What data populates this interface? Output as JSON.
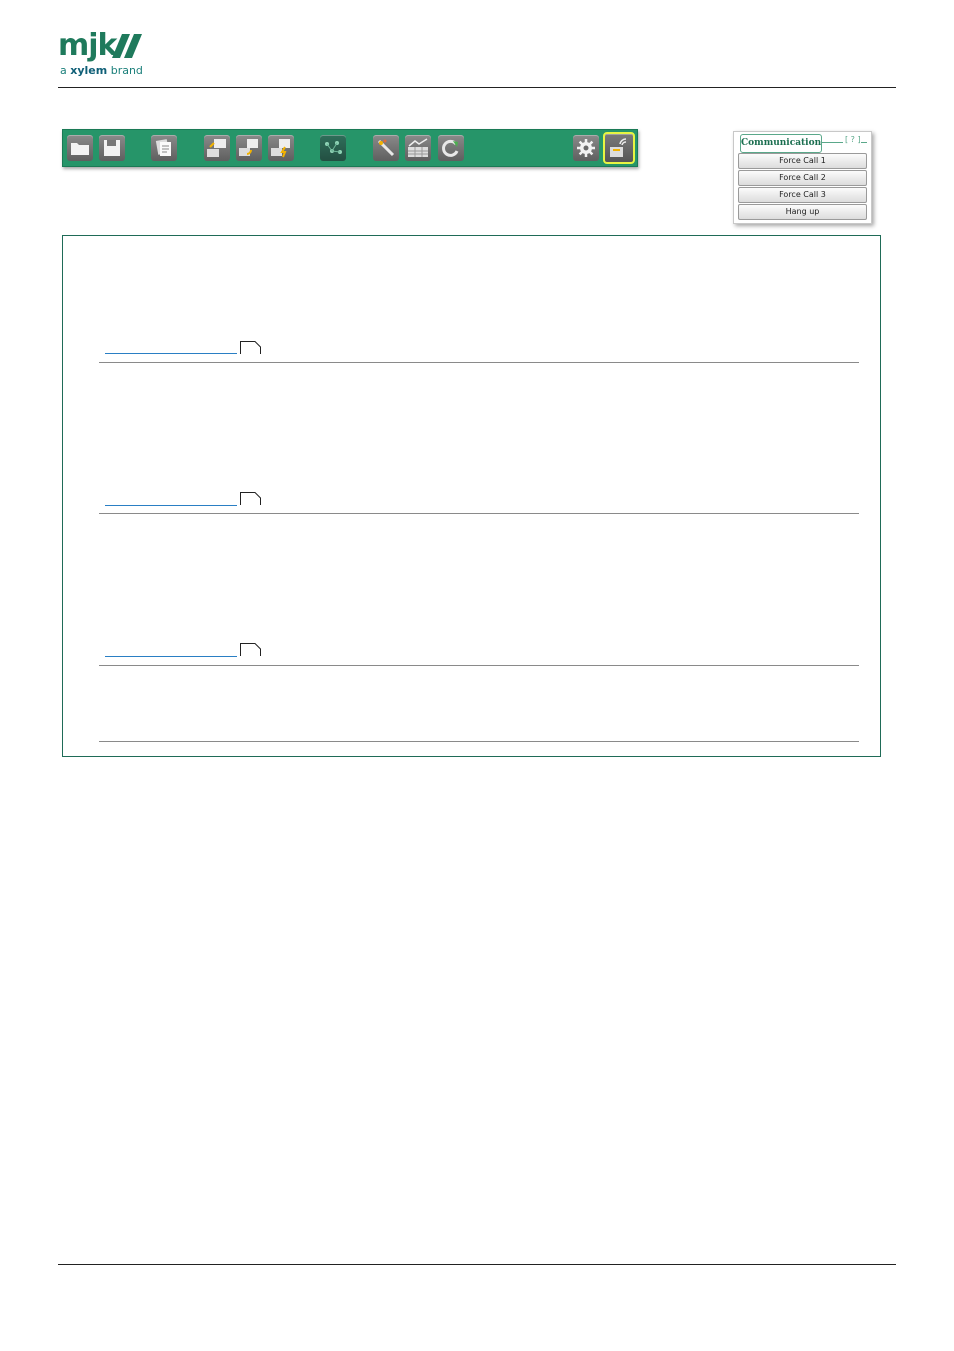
{
  "header": {
    "logo_text": "mjk//",
    "brand_prefix": "a",
    "brand_name": "xylem",
    "brand_suffix": "brand"
  },
  "colors": {
    "brand_green": "#1f7a5c",
    "toolbar_green": "#269569",
    "highlight_yellow": "#e7f542",
    "link_blue": "#2a7fc4"
  },
  "toolbar": {
    "buttons": [
      {
        "icon": "folder-icon"
      },
      {
        "icon": "save-icon"
      },
      {
        "icon": "documents-icon"
      },
      {
        "icon": "computer-upload-icon"
      },
      {
        "icon": "computer-sync-icon"
      },
      {
        "icon": "computer-flash-icon"
      },
      {
        "icon": "network-icon"
      },
      {
        "icon": "tools-icon"
      },
      {
        "icon": "table-chart-icon"
      },
      {
        "icon": "refresh-icon"
      },
      {
        "icon": "settings-gear-icon"
      },
      {
        "icon": "communication-icon",
        "highlighted": true
      }
    ]
  },
  "communication_panel": {
    "title": "Communication",
    "help": "[ ? ]",
    "buttons": [
      "Force Call 1",
      "Force Call 2",
      "Force Call 3",
      "Hang up"
    ]
  }
}
